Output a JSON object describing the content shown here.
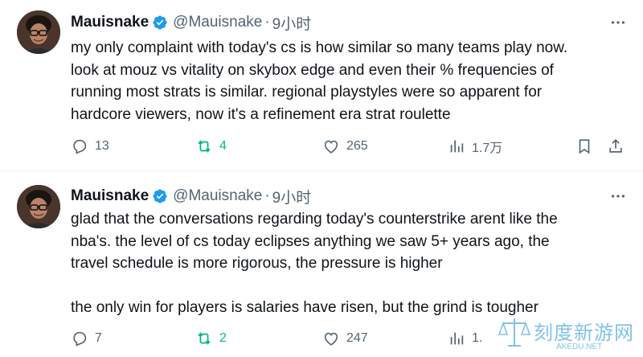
{
  "tweets": [
    {
      "author": "Mauisnake",
      "handle": "@Mauisnake",
      "separator": "·",
      "time": "9小时",
      "text": "my only complaint with today's cs is how similar so many teams play now.\nlook at mouz vs vitality on skybox edge and even their % frequencies of\nrunning most strats is similar. regional playstyles were so apparent for\nhardcore viewers, now it's a refinement era strat roulette",
      "replies": "13",
      "reposts": "4",
      "likes": "265",
      "views": "1.7万"
    },
    {
      "author": "Mauisnake",
      "handle": "@Mauisnake",
      "separator": "·",
      "time": "9小时",
      "text": "glad that the conversations regarding today's counterstrike arent like the\nnba's. the level of cs today eclipses anything we saw 5+ years ago, the\ntravel schedule is more rigorous, the pressure is higher\n\nthe only win for players is salaries have risen, but the grind is tougher",
      "replies": "7",
      "reposts": "2",
      "likes": "247",
      "views": "1."
    }
  ],
  "colors": {
    "verified": "#1d9bf0",
    "repost": "#00ba7c",
    "secondary": "#536471"
  },
  "icons": [
    "verified-badge-icon",
    "more-icon",
    "reply-icon",
    "repost-icon",
    "like-icon",
    "views-icon",
    "bookmark-icon",
    "share-icon"
  ],
  "watermark": {
    "text": "刻度新游网",
    "sub": "AKEDU.NET"
  }
}
